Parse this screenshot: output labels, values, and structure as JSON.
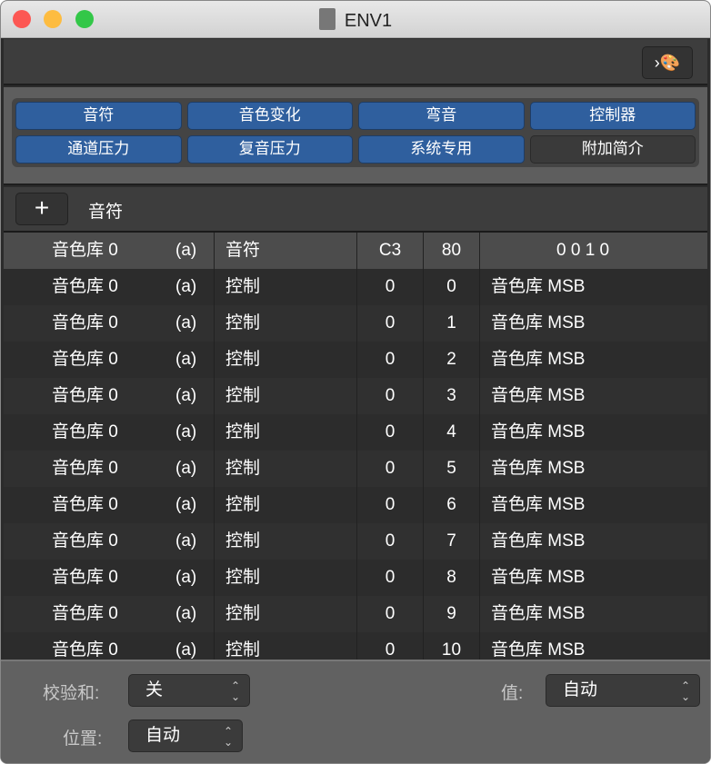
{
  "window": {
    "title": "ENV1",
    "close_color": "#fc5753",
    "min_color": "#fdbc40",
    "max_color": "#33c748"
  },
  "toolbar": {
    "palette_label": "›🎨"
  },
  "filters": [
    {
      "label": "音符",
      "on": true
    },
    {
      "label": "音色变化",
      "on": true
    },
    {
      "label": "弯音",
      "on": true
    },
    {
      "label": "控制器",
      "on": true
    },
    {
      "label": "通道压力",
      "on": true
    },
    {
      "label": "复音压力",
      "on": true
    },
    {
      "label": "系统专用",
      "on": true
    },
    {
      "label": "附加简介",
      "on": false
    }
  ],
  "add_row": {
    "plus": "+",
    "label": "音符"
  },
  "rows": [
    {
      "bank": "音色库 0",
      "a": "(a)",
      "type": "音符",
      "v1": "C3",
      "v2": "80",
      "desc": "0 0 1     0"
    },
    {
      "bank": "音色库 0",
      "a": "(a)",
      "type": "控制",
      "v1": "0",
      "v2": "0",
      "desc": "音色库 MSB"
    },
    {
      "bank": "音色库 0",
      "a": "(a)",
      "type": "控制",
      "v1": "0",
      "v2": "1",
      "desc": "音色库 MSB"
    },
    {
      "bank": "音色库 0",
      "a": "(a)",
      "type": "控制",
      "v1": "0",
      "v2": "2",
      "desc": "音色库 MSB"
    },
    {
      "bank": "音色库 0",
      "a": "(a)",
      "type": "控制",
      "v1": "0",
      "v2": "3",
      "desc": "音色库 MSB"
    },
    {
      "bank": "音色库 0",
      "a": "(a)",
      "type": "控制",
      "v1": "0",
      "v2": "4",
      "desc": "音色库 MSB"
    },
    {
      "bank": "音色库 0",
      "a": "(a)",
      "type": "控制",
      "v1": "0",
      "v2": "5",
      "desc": "音色库 MSB"
    },
    {
      "bank": "音色库 0",
      "a": "(a)",
      "type": "控制",
      "v1": "0",
      "v2": "6",
      "desc": "音色库 MSB"
    },
    {
      "bank": "音色库 0",
      "a": "(a)",
      "type": "控制",
      "v1": "0",
      "v2": "7",
      "desc": "音色库 MSB"
    },
    {
      "bank": "音色库 0",
      "a": "(a)",
      "type": "控制",
      "v1": "0",
      "v2": "8",
      "desc": "音色库 MSB"
    },
    {
      "bank": "音色库 0",
      "a": "(a)",
      "type": "控制",
      "v1": "0",
      "v2": "9",
      "desc": "音色库 MSB"
    },
    {
      "bank": "音色库 0",
      "a": "(a)",
      "type": "控制",
      "v1": "0",
      "v2": "10",
      "desc": "音色库 MSB"
    }
  ],
  "footer": {
    "checksum_label": "校验和:",
    "checksum_value": "关",
    "value_label": "值:",
    "value_value": "自动",
    "position_label": "位置:",
    "position_value": "自动"
  }
}
